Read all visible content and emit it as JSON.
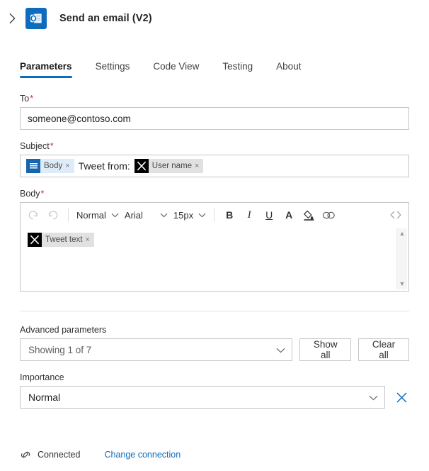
{
  "header": {
    "expand_icon": "chevron-right-icon",
    "app_icon": "outlook-icon",
    "title": "Send an email (V2)"
  },
  "tabs": [
    {
      "label": "Parameters",
      "active": true
    },
    {
      "label": "Settings",
      "active": false
    },
    {
      "label": "Code View",
      "active": false
    },
    {
      "label": "Testing",
      "active": false
    },
    {
      "label": "About",
      "active": false
    }
  ],
  "fields": {
    "to": {
      "label": "To",
      "required_marker": "*",
      "value": "someone@contoso.com"
    },
    "subject": {
      "label": "Subject",
      "required_marker": "*",
      "tokens": [
        {
          "icon": "body-lines-icon",
          "text": "Body",
          "remove": "×",
          "style": "blue"
        },
        {
          "icon": "x-twitter-icon",
          "text": "User name",
          "remove": "×",
          "style": "gray"
        }
      ],
      "static_text": "Tweet from:"
    },
    "body": {
      "label": "Body",
      "required_marker": "*",
      "token": {
        "icon": "x-twitter-icon",
        "text": "Tweet text",
        "remove": "×",
        "style": "gray"
      }
    }
  },
  "rte_toolbar": {
    "undo": "undo-icon",
    "redo": "redo-icon",
    "style_select": "Normal",
    "font_select": "Arial",
    "size_select": "15px",
    "bold": "B",
    "italic": "I",
    "underline": "U",
    "font_color": "A",
    "highlight": "highlight-icon",
    "link": "link-icon",
    "code_view": "‹›",
    "chevron": "⌄"
  },
  "advanced": {
    "label": "Advanced parameters",
    "select_value": "Showing 1 of 7",
    "show_all_label": "Show all",
    "clear_all_label": "Clear all"
  },
  "importance": {
    "label": "Importance",
    "value": "Normal",
    "remove_icon": "close-icon"
  },
  "footer": {
    "status_icon": "connection-icon",
    "status_text": "Connected",
    "link_text": "Change connection"
  },
  "colors": {
    "accent": "#0f6cbd",
    "required": "#c4314b",
    "token_blue": "#deecf9",
    "token_gray": "#e1e1e1",
    "border": "#c8c6c4"
  }
}
